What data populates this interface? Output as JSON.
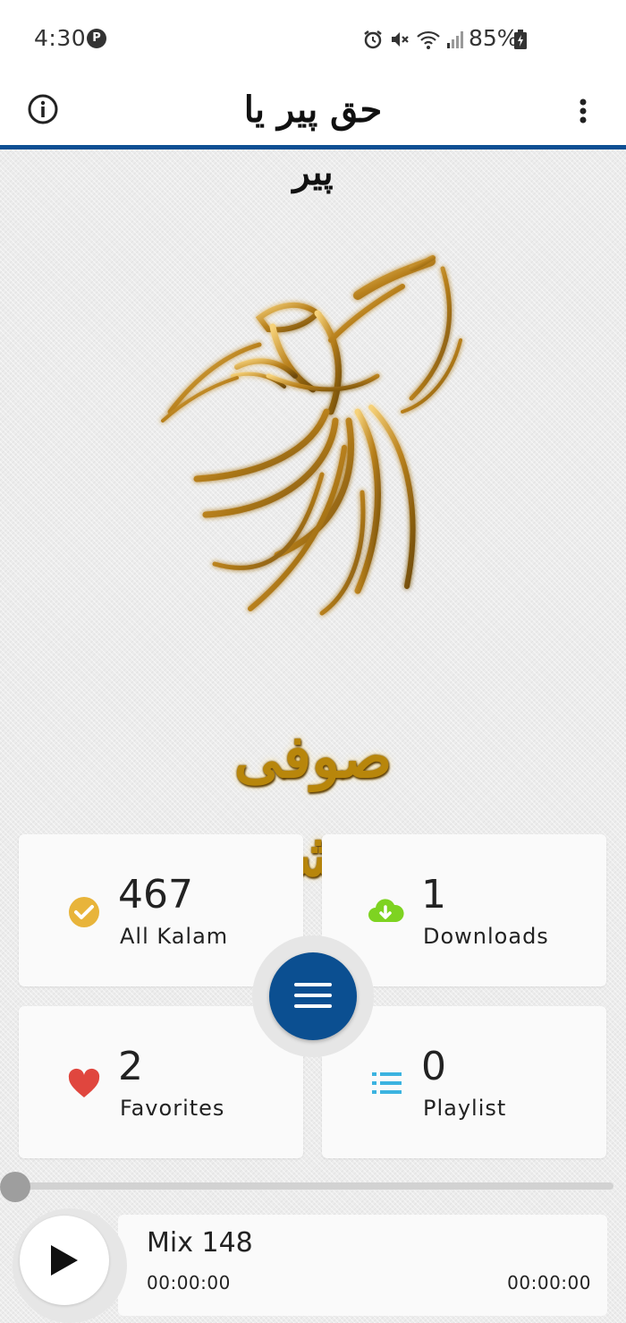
{
  "status_bar": {
    "time": "4:30",
    "app_badge": "P",
    "battery_percent": "85%",
    "icons": [
      "alarm-icon",
      "mute-icon",
      "wifi-icon",
      "signal-icon",
      "battery-charging-icon"
    ]
  },
  "app_bar": {
    "title": "حق پیر یا پیر",
    "left_icon": "info-icon",
    "right_icon": "more-vert-icon"
  },
  "hero": {
    "logo_icon": "whirling-dervish-logo",
    "caption": "صوفی عشق"
  },
  "stats": [
    {
      "count": "467",
      "label": "All Kalam",
      "icon": "check-circle-icon",
      "color": "#e8b43a"
    },
    {
      "count": "1",
      "label": "Downloads",
      "icon": "cloud-download-icon",
      "color": "#7ed321"
    },
    {
      "count": "2",
      "label": "Favorites",
      "icon": "heart-icon",
      "color": "#e0463e"
    },
    {
      "count": "0",
      "label": "Playlist",
      "icon": "list-icon",
      "color": "#3bb3e0"
    }
  ],
  "menu_button": {
    "icon": "menu-icon",
    "color": "#0b4f91"
  },
  "player": {
    "progress": 0,
    "track_title": "Mix 148",
    "current_time": "00:00:00",
    "total_time": "00:00:00",
    "play_icon": "play-icon"
  }
}
